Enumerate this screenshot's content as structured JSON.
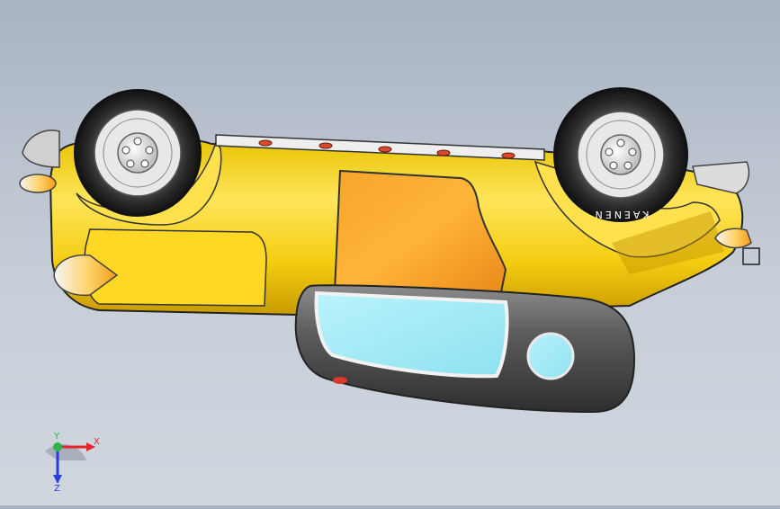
{
  "viewport": {
    "background_top": "#a9b4c2",
    "background_bottom": "#cfd6de"
  },
  "model": {
    "tire_brand": "KAENEN",
    "colors": {
      "body_yellow": "#f6d21a",
      "door_orange": "#f7a126",
      "glass_cyan": "#9fe8f5",
      "panel_gray": "#4a4a4a",
      "tire_dark": "#2b2b2b",
      "chrome": "#d9d9d9"
    }
  },
  "triad": {
    "x_label": "X",
    "y_label": "Y",
    "z_label": "Z",
    "x_color": "#e3262a",
    "y_color": "#2ab24b",
    "z_color": "#2a3fd8"
  }
}
